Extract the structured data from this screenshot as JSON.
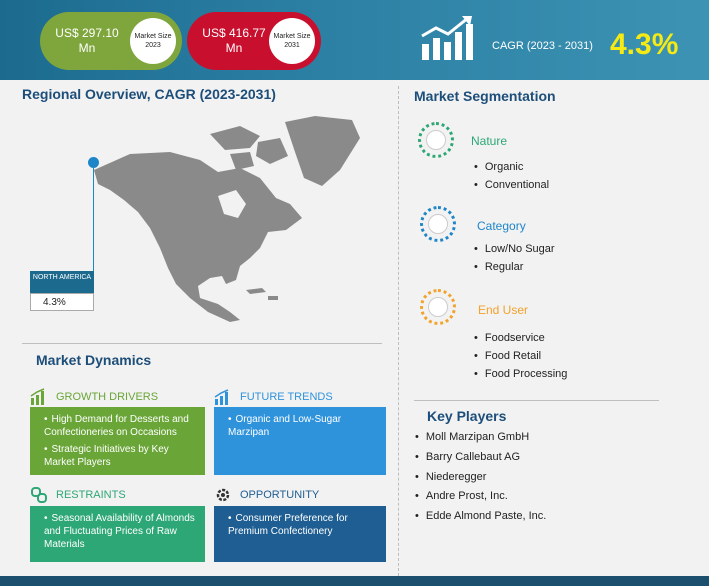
{
  "header": {
    "size_2023_value": "US$ 297.10 Mn",
    "size_2023_label": "Market Size 2023",
    "size_2031_value": "US$ 416.77 Mn",
    "size_2031_label": "Market Size 2031",
    "cagr_label": "CAGR (2023 - 2031)",
    "cagr_value": "4.3%"
  },
  "regional": {
    "title": "Regional Overview, CAGR (2023-2031)",
    "region_name": "NORTH AMERICA",
    "region_cagr": "4.3%"
  },
  "segmentation": {
    "title": "Market Segmentation",
    "groups": [
      {
        "name": "Nature",
        "color": "#2ea776",
        "items": [
          "Organic",
          "Conventional"
        ]
      },
      {
        "name": "Category",
        "color": "#1e86c8",
        "items": [
          "Low/No Sugar",
          "Regular"
        ]
      },
      {
        "name": "End User",
        "color": "#f3a22a",
        "items": [
          "Foodservice",
          "Food Retail",
          "Food Processing"
        ]
      }
    ]
  },
  "key_players": {
    "title": "Key Players",
    "items": [
      "Moll Marzipan GmbH",
      "Barry Callebaut AG",
      "Niederegger",
      "Andre Prost, Inc.",
      "Edde Almond Paste, Inc."
    ]
  },
  "dynamics": {
    "title": "Market Dynamics",
    "growth_drivers": {
      "label": "GROWTH DRIVERS",
      "color": "#6aa537",
      "items": [
        "High Demand for Desserts and Confectioneries on Occasions",
        "Strategic Initiatives by Key Market Players"
      ]
    },
    "future_trends": {
      "label": "FUTURE TRENDS",
      "color": "#2f93dc",
      "items": [
        "Organic and Low-Sugar Marzipan"
      ]
    },
    "restraints": {
      "label": "RESTRAINTS",
      "color": "#2ea776",
      "items": [
        "Seasonal Availability of Almonds and Fluctuating Prices of Raw Materials"
      ]
    },
    "opportunity": {
      "label": "OPPORTUNITY",
      "color": "#1f5e93",
      "items": [
        "Consumer Preference for Premium Confectionery"
      ]
    }
  }
}
